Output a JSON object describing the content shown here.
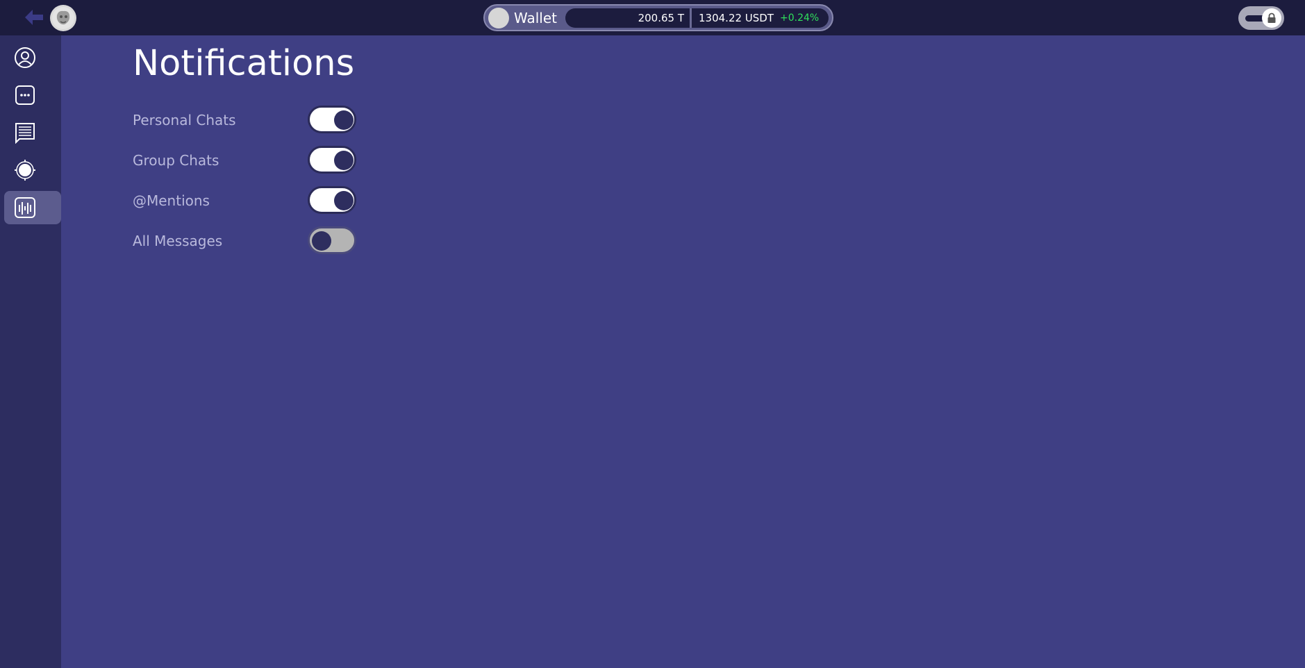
{
  "header": {
    "back_icon": "arrow-left-icon",
    "avatar_icon": "user-avatar",
    "wallet": {
      "label": "Wallet",
      "token_balance": "200.65 T",
      "usdt_balance": "1304.22 USDT",
      "change": "+0.24%",
      "change_color": "#2fe05b"
    },
    "lock_icon": "lock-icon"
  },
  "sidebar": {
    "items": [
      {
        "icon": "profile-icon",
        "active": false
      },
      {
        "icon": "chat-dots-icon",
        "active": false
      },
      {
        "icon": "messages-list-icon",
        "active": false
      },
      {
        "icon": "appearance-icon",
        "active": false
      },
      {
        "icon": "notifications-wave-icon",
        "active": true
      }
    ]
  },
  "main": {
    "title": "Notifications",
    "settings": [
      {
        "label": "Personal Chats",
        "enabled": true
      },
      {
        "label": "Group Chats",
        "enabled": true
      },
      {
        "label": "@Mentions",
        "enabled": true
      },
      {
        "label": "All Messages",
        "enabled": false
      }
    ]
  },
  "colors": {
    "background": "#3f3f84",
    "topbar": "#1c1c3e",
    "sidebar": "#2d2d60",
    "accent": "#2e2e5f"
  }
}
